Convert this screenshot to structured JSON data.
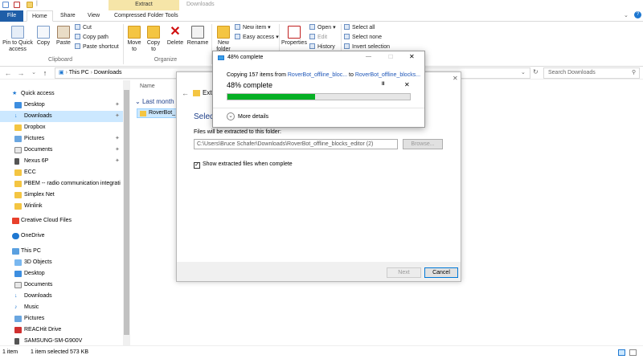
{
  "titlebar": {
    "extract_tab": "Extract",
    "title": "Downloads",
    "min": "—",
    "max": "☐",
    "close": "✕"
  },
  "ribbon_tabs": {
    "file": "File",
    "home": "Home",
    "share": "Share",
    "view": "View",
    "tools": "Compressed Folder Tools"
  },
  "ribbon": {
    "pin": "Pin to Quick access",
    "copy": "Copy",
    "paste": "Paste",
    "cut": "Cut",
    "copy_path": "Copy path",
    "paste_shortcut": "Paste shortcut",
    "clipboard": "Clipboard",
    "move_to": "Move to",
    "copy_to": "Copy to",
    "delete": "Delete",
    "rename": "Rename",
    "organize": "Organize",
    "new_folder": "New folder",
    "new_item": "New item",
    "easy_access": "Easy access",
    "properties": "Properties",
    "open": "Open",
    "edit": "Edit",
    "history": "History",
    "select_all": "Select all",
    "select_none": "Select none",
    "invert_selection": "Invert selection"
  },
  "address": {
    "this_pc": "This PC",
    "sep": "›",
    "downloads": "Downloads",
    "search_placeholder": "Search Downloads"
  },
  "nav": {
    "quick_access": "Quick access",
    "desktop": "Desktop",
    "downloads": "Downloads",
    "dropbox": "Dropbox",
    "pictures": "Pictures",
    "documents": "Documents",
    "nexus": "Nexus 6P",
    "ecc": "ECC",
    "pbem": "PBEM -- radio communication integrati",
    "simplex": "Simplex Net",
    "winlink": "Winlink",
    "creative_cloud": "Creative Cloud Files",
    "onedrive": "OneDrive",
    "this_pc": "This PC",
    "objects3d": "3D Objects",
    "desktop2": "Desktop",
    "documents2": "Documents",
    "downloads2": "Downloads",
    "music": "Music",
    "pictures2": "Pictures",
    "reachit": "REACHit Drive",
    "samsung": "SAMSUNG-SM-G900V"
  },
  "content": {
    "name_header": "Name",
    "group": "Last month",
    "file": "RoverBot_"
  },
  "status": {
    "count": "1 item",
    "selected": "1 item selected  573 KB"
  },
  "dialog": {
    "title": "Extract",
    "heading": "Select",
    "label": "Files will be extracted to this folder:",
    "path": "C:\\Users\\Bruce Schafer\\Downloads\\RoverBot_offline_blocks_editor (2)",
    "browse": "Browse...",
    "checkbox": "Show extracted files when complete",
    "next": "Next",
    "cancel": "Cancel"
  },
  "progress": {
    "title": "48% complete",
    "copying_prefix": "Copying 157 items from",
    "src": "RoverBot_offline_bloc...",
    "to": "to",
    "dst": "RoverBot_offline_blocks...",
    "percent_text": "48% complete",
    "percent": 48,
    "more_details": "More details",
    "pause": "II",
    "stop": "✕",
    "min": "—",
    "max": "☐",
    "close": "✕"
  },
  "colors": {
    "accent": "#1f5ea8",
    "progress": "#06b025",
    "extract_tab": "#f6e5a8"
  }
}
